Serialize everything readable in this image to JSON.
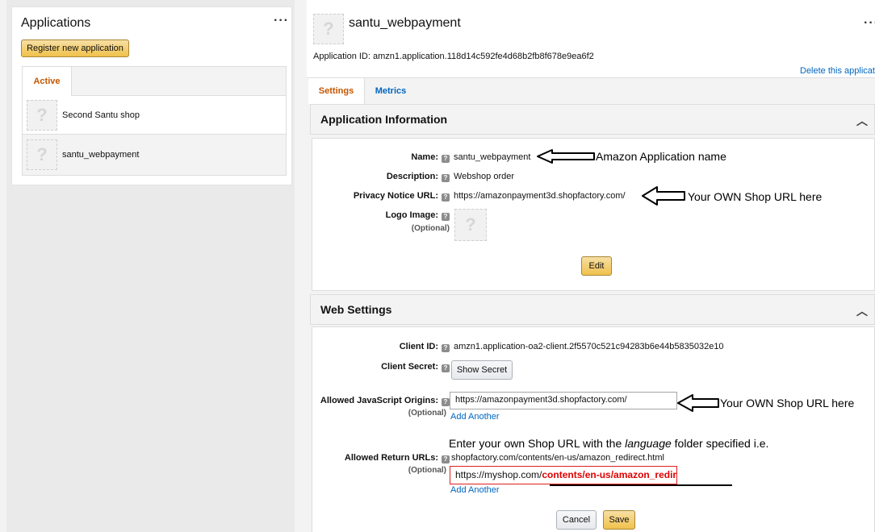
{
  "left": {
    "title": "Applications",
    "menu": "···",
    "register_button": "Register new application",
    "tab_active": "Active",
    "apps": [
      {
        "name": "Second Santu shop"
      },
      {
        "name": "santu_webpayment"
      }
    ]
  },
  "header": {
    "app_name": "santu_webpayment",
    "menu": "···",
    "app_id_line": "Application ID: amzn1.application.118d14c592fe4d68b2fb8f678e9ea6f2",
    "delete_link": "Delete this applicatio"
  },
  "tabs": [
    {
      "label": "Settings"
    },
    {
      "label": "Metrics"
    }
  ],
  "app_info": {
    "title": "Application Information",
    "name_label": "Name:",
    "name_value": "santu_webpayment",
    "desc_label": "Description:",
    "desc_value": "Webshop order",
    "privacy_label": "Privacy Notice URL:",
    "privacy_value": "https://amazonpayment3d.shopfactory.com/",
    "logo_label": "Logo Image:",
    "logo_optional": "(Optional)",
    "edit_button": "Edit"
  },
  "web_settings": {
    "title": "Web Settings",
    "client_id_label": "Client ID:",
    "client_id_value": "amzn1.application-oa2-client.2f5570c521c94283b6e44b5835032e10",
    "client_secret_label": "Client Secret:",
    "show_secret_button": "Show Secret",
    "js_origins_label": "Allowed JavaScript Origins:",
    "js_origins_optional": "(Optional)",
    "js_origins_value": "https://amazonpayment3d.shopfactory.com/",
    "add_another_1": "Add Another",
    "return_urls_label": "Allowed Return URLs:",
    "return_urls_optional": "(Optional)",
    "return_url_value": "shopfactory.com/contents/en-us/amazon_redirect.html",
    "return_url_edit_prefix": "https://myshop.com/",
    "return_url_edit_path": "contents/en-us/amazon_redirect.html",
    "add_another_2": "Add Another",
    "cancel_button": "Cancel",
    "save_button": "Save"
  },
  "annotations": {
    "app_name_note": "Amazon Application name",
    "shop_url_note_1": "Your OWN Shop URL here",
    "shop_url_note_2": "Your OWN Shop URL here",
    "return_note_before": "Enter your own Shop URL with the ",
    "return_note_em": "language",
    "return_note_after": " folder specified i.e."
  },
  "colors": {
    "accent_orange": "#c45500",
    "link_blue": "#0066c0",
    "button_yellow": "#f0c14b",
    "highlight_red": "#e00000"
  }
}
